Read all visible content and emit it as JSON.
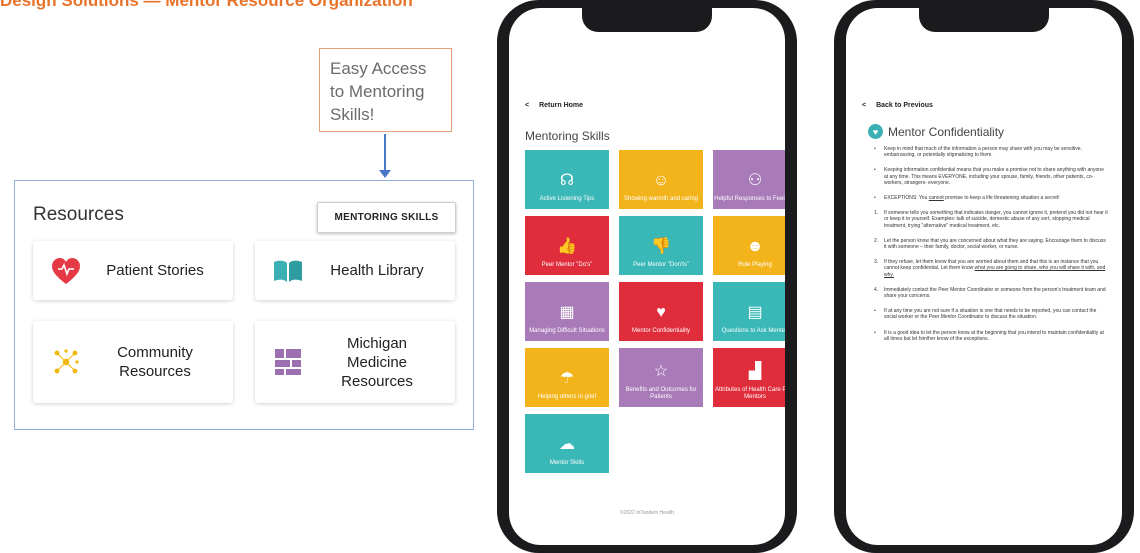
{
  "header": {
    "title": "Design Solutions — Mentor Resource Organization"
  },
  "callout": {
    "lines": [
      "Easy Access",
      "to Mentoring",
      "Skills!"
    ]
  },
  "resources": {
    "title": "Resources",
    "button_label": "MENTORING SKILLS",
    "cards": [
      {
        "label": "Patient Stories",
        "icon": "heart-icon",
        "color": "#e63946"
      },
      {
        "label": "Health Library",
        "icon": "book-icon",
        "color": "#3ab0b5"
      },
      {
        "label": "Community Resources",
        "label_lines": [
          "Community",
          "Resources"
        ],
        "icon": "network-icon",
        "color": "#f2b705"
      },
      {
        "label": "Michigan Medicine Resources",
        "label_lines": [
          "Michigan",
          "Medicine",
          "Resources"
        ],
        "icon": "grid-icon",
        "color": "#9b6fb0"
      }
    ]
  },
  "phone1": {
    "back_label": "Return Home",
    "title": "Mentoring Skills",
    "tiles": [
      {
        "label": "Active Listening Tips",
        "icon": "listening-icon",
        "color": "#3ab7b7"
      },
      {
        "label": "Showing warmth and caring",
        "icon": "warmth-icon",
        "color": "#f3b41b"
      },
      {
        "label": "Helpful Responses to Feelings",
        "icon": "responses-icon",
        "color": "#a87bb8"
      },
      {
        "label": "Peer Mentor \"Do's\"",
        "icon": "thumbs-up-icon",
        "color": "#e02d3c"
      },
      {
        "label": "Peer Mentor \"Don'ts\"",
        "icon": "thumbs-down-icon",
        "color": "#3ab7b7"
      },
      {
        "label": "Role Playing",
        "icon": "masks-icon",
        "color": "#f3b41b"
      },
      {
        "label": "Managing Difficult Situations",
        "icon": "maze-icon",
        "color": "#a87bb8"
      },
      {
        "label": "Mentor Confidentiality",
        "icon": "heart-icon",
        "color": "#e02d3c"
      },
      {
        "label": "Questions to Ask Mentee",
        "icon": "clipboard-icon",
        "color": "#3ab7b7"
      },
      {
        "label": "Helping others in grief",
        "icon": "grief-icon",
        "color": "#f3b41b"
      },
      {
        "label": "Benefits and Outcomes for Patients",
        "icon": "star-icon",
        "color": "#a87bb8"
      },
      {
        "label": "Attributes of Health Care Peer Mentors",
        "icon": "stairs-icon",
        "color": "#e02d3c"
      },
      {
        "label": "Mentor Skills",
        "icon": "brain-icon",
        "color": "#3ab7b7"
      }
    ],
    "footer": "©2022 InTandem Health"
  },
  "phone2": {
    "back_label": "Back to Previous",
    "title": "Mentor Confidentiality",
    "bullets": [
      {
        "marker": "•",
        "text": "Keep in mind that much of the information a person may share with you may be sensitive, embarrassing, or potentially stigmatizing to them."
      },
      {
        "marker": "•",
        "text": "Keeping information confidential means that you make a promise not to share anything with anyone at any time. This means EVERYONE, including your spouse, family, friends, other patients, co-workers, strangers- everyone."
      },
      {
        "marker": "•",
        "text_pre": "EXCEPTIONS: You ",
        "text_u": "cannot",
        "text_post": " promise to keep a life threatening situation a secret!"
      },
      {
        "marker": "1.",
        "text": "If someone tells you something that indicates danger, you cannot ignore it, pretend you did not hear it or keep it to yourself. Examples: talk of suicide, domestic abuse of any sort, stopping medical treatment, trying \"alternative\" medical treatment, etc."
      },
      {
        "marker": "2.",
        "text": "Let the person know that you are concerned about what they are saying. Encourage them to discuss it with someone – their family, doctor, social worker, or nurse."
      },
      {
        "marker": "3.",
        "text_pre": "If they refuse, let them know that you are worried about them and that this is an instance that you cannot keep confidential. Let them know ",
        "text_u": "what you are going to share, who you will share it with, and why.",
        "text_post": ""
      },
      {
        "marker": "4.",
        "text": "Immediately contact the Peer Mentor Coordinator or someone from the person's treatment team and share your concerns."
      },
      {
        "marker": "•",
        "text": "If at any time you are not sure if a situation is one that needs to be reported, you can contact the social worker or the Peer Mentor Coordinator to discuss the situation."
      },
      {
        "marker": "•",
        "text": "It is a good idea to let the person know at the beginning that you intend to maintain confidentiality at all times but let him/her know of the exceptions."
      }
    ]
  }
}
